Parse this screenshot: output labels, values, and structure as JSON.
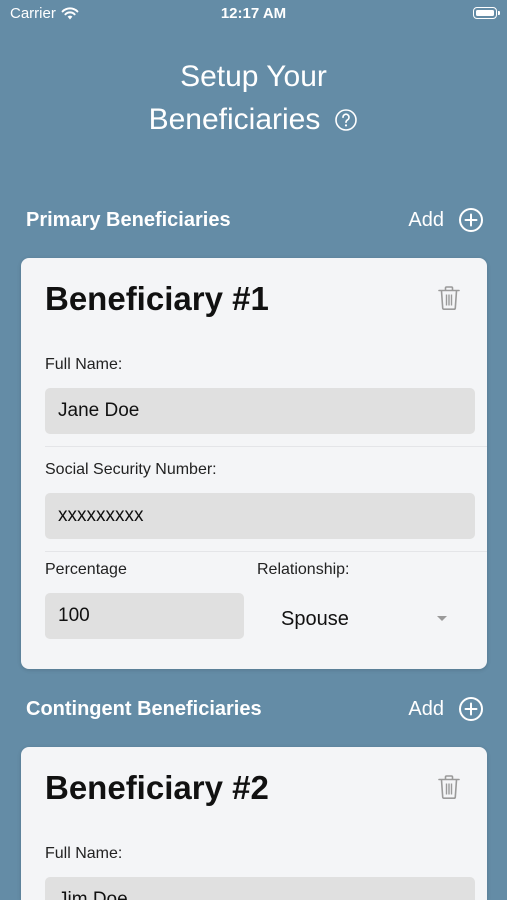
{
  "status_bar": {
    "carrier": "Carrier",
    "time": "12:17 AM"
  },
  "header": {
    "title_line1": "Setup Your",
    "title_line2": "Beneficiaries"
  },
  "primary": {
    "section_title": "Primary Beneficiaries",
    "add_label": "Add",
    "beneficiary": {
      "title": "Beneficiary #1",
      "full_name_label": "Full Name:",
      "full_name": "Jane Doe",
      "ssn_label": "Social Security Number:",
      "ssn": "xxxxxxxxx",
      "percentage_label": "Percentage",
      "percentage": "100",
      "relationship_label": "Relationship:",
      "relationship": "Spouse"
    }
  },
  "contingent": {
    "section_title": "Contingent Beneficiaries",
    "add_label": "Add",
    "beneficiary": {
      "title": "Beneficiary #2",
      "full_name_label": "Full Name:",
      "full_name": "Jim Doe"
    }
  },
  "icons": {
    "wifi": "wifi-icon",
    "battery": "battery-icon",
    "help": "help-icon",
    "add": "add-circle-icon",
    "delete": "trash-icon",
    "dropdown": "chevron-down-icon"
  },
  "colors": {
    "background": "#648ca6",
    "card": "#f4f5f7",
    "input": "#e0e0e0"
  }
}
